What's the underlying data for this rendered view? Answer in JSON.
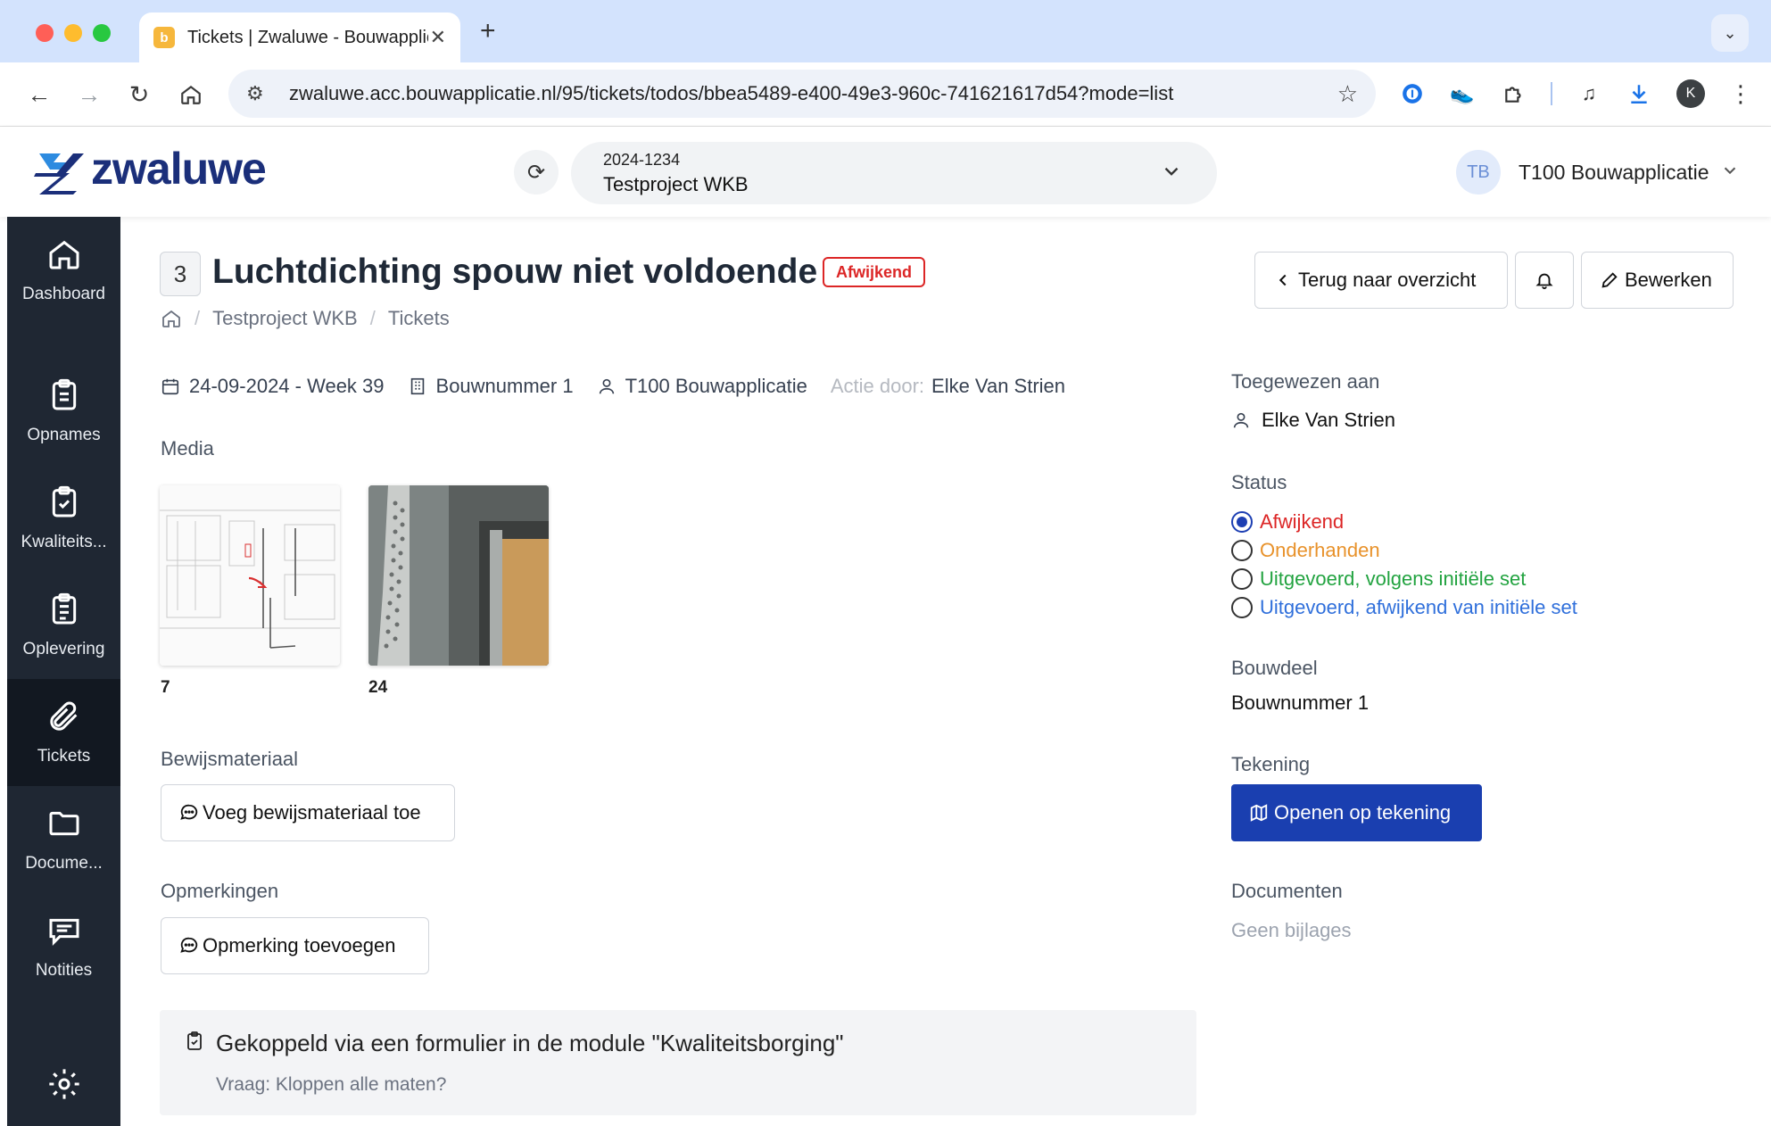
{
  "browser": {
    "tab_title": "Tickets | Zwaluwe - Bouwapplicatie",
    "url": "zwaluwe.acc.bouwapplicatie.nl/95/tickets/todos/bbea5489-e400-49e3-960c-741621617d54?mode=list",
    "profile_initial": "K"
  },
  "header": {
    "logo_text": "zwaluwe",
    "project_code": "2024-1234",
    "project_name": "Testproject WKB",
    "user_initials": "TB",
    "user_name": "T100 Bouwapplicatie"
  },
  "sidebar": {
    "items": [
      {
        "label": "Dashboard",
        "icon": "home-icon"
      },
      {
        "label": "Opnames",
        "icon": "clipboard-icon"
      },
      {
        "label": "Kwaliteits...",
        "icon": "clipboard-check-icon"
      },
      {
        "label": "Oplevering",
        "icon": "clipboard-list-icon"
      },
      {
        "label": "Tickets",
        "icon": "paperclip-icon"
      },
      {
        "label": "Docume...",
        "icon": "folder-icon"
      },
      {
        "label": "Notities",
        "icon": "message-icon"
      }
    ]
  },
  "ticket": {
    "number": "3",
    "title": "Luchtdichting spouw niet voldoende",
    "status_badge": "Afwijkend",
    "breadcrumb": [
      "Testproject WKB",
      "Tickets"
    ],
    "date": "24-09-2024 - Week 39",
    "build_number": "Bouwnummer 1",
    "creator": "T100 Bouwapplicatie",
    "action_by_label": "Actie door:",
    "action_by": "Elke Van Strien"
  },
  "actions": {
    "back": "Terug naar overzicht",
    "edit": "Bewerken"
  },
  "media": {
    "label": "Media",
    "items": [
      {
        "number": "7",
        "kind": "drawing"
      },
      {
        "number": "24",
        "kind": "photo"
      }
    ]
  },
  "evidence": {
    "label": "Bewijsmateriaal",
    "button": "Voeg bewijsmateriaal toe"
  },
  "remarks": {
    "label": "Opmerkingen",
    "button": "Opmerking toevoegen"
  },
  "linked": {
    "title": "Gekoppeld via een formulier in de module \"Kwaliteitsborging\"",
    "question": "Vraag: Kloppen alle maten?"
  },
  "panel": {
    "assigned_label": "Toegewezen aan",
    "assigned_value": "Elke Van Strien",
    "status_label": "Status",
    "status_options": [
      {
        "label": "Afwijkend",
        "color": "#dc2626",
        "selected": true
      },
      {
        "label": "Onderhanden",
        "color": "#e8922b",
        "selected": false
      },
      {
        "label": "Uitgevoerd, volgens initiële set",
        "color": "#22a340",
        "selected": false
      },
      {
        "label": "Uitgevoerd, afwijkend van initiële set",
        "color": "#2f6fdb",
        "selected": false
      }
    ],
    "bouwdeel_label": "Bouwdeel",
    "bouwdeel_value": "Bouwnummer 1",
    "tekening_label": "Tekening",
    "tekening_button": "Openen op tekening",
    "documents_label": "Documenten",
    "documents_value": "Geen bijlages"
  },
  "colors": {
    "primary": "#1a3fb0",
    "sidebar": "#1f2733",
    "danger": "#dc2626"
  }
}
